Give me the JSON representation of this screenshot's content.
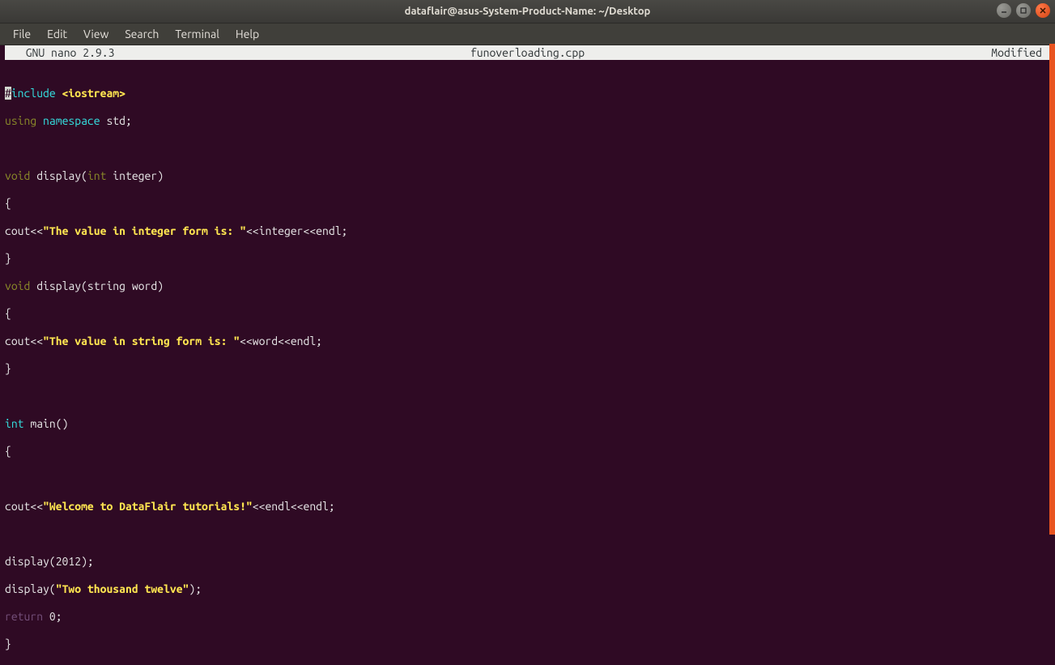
{
  "window": {
    "title": "dataflair@asus-System-Product-Name: ~/Desktop"
  },
  "menu": {
    "file": "File",
    "edit": "Edit",
    "view": "View",
    "search": "Search",
    "terminal": "Terminal",
    "help": "Help"
  },
  "status": {
    "app": "  GNU nano 2.9.3",
    "filename": "funoverloading.cpp",
    "modified": "Modified"
  },
  "code": {
    "hash": "#",
    "include": "include",
    "iostream": " <iostream>",
    "using": "using",
    "namespace": " namespace",
    "std_semi": " std;",
    "void1": "void",
    "display_open1": " display(",
    "int_kw": "int",
    "integer_param": " integer)",
    "brace_open": "{",
    "cout1a": "cout<<",
    "str_int": "\"The value in integer form is: \"",
    "cout1b": "<<integer<<endl;",
    "brace_close": "}",
    "void2": "void",
    "display_open2": " display(string word)",
    "cout2a": "cout<<",
    "str_str": "\"The value in string form is: \"",
    "cout2b": "<<word<<endl;",
    "int_main": "int",
    "main_sig": " main()",
    "cout3a": "cout<<",
    "str_welcome": "\"Welcome to DataFlair tutorials!\"",
    "cout3b": "<<endl<<endl;",
    "call1": "display(2012);",
    "call2a": "display(",
    "str_twth": "\"Two thousand twelve\"",
    "call2b": ");",
    "return": "return",
    "zero": " 0;"
  }
}
